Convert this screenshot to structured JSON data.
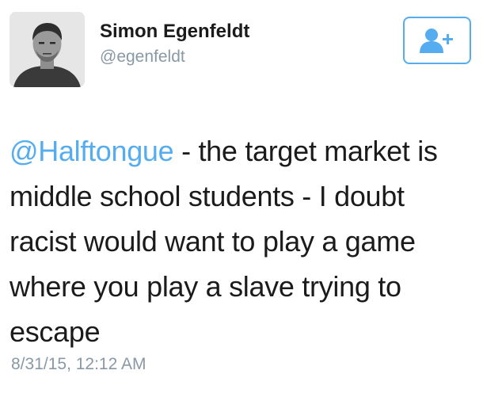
{
  "author": {
    "name": "Simon Egenfeldt",
    "handle": "@egenfeldt"
  },
  "follow_button": {
    "icon": "add-user-icon"
  },
  "tweet": {
    "mention": "@Halftongue",
    "text_line1_rest": " - the target market is",
    "text_rest": "middle school students - I doubt\nracist would want to play a game\nwhere you play a slave trying to\nescape",
    "timestamp": "8/31/15, 12:12 AM"
  },
  "colors": {
    "accent": "#55acee",
    "secondary_text": "#8899a6",
    "primary_text": "#1b1b1b"
  }
}
